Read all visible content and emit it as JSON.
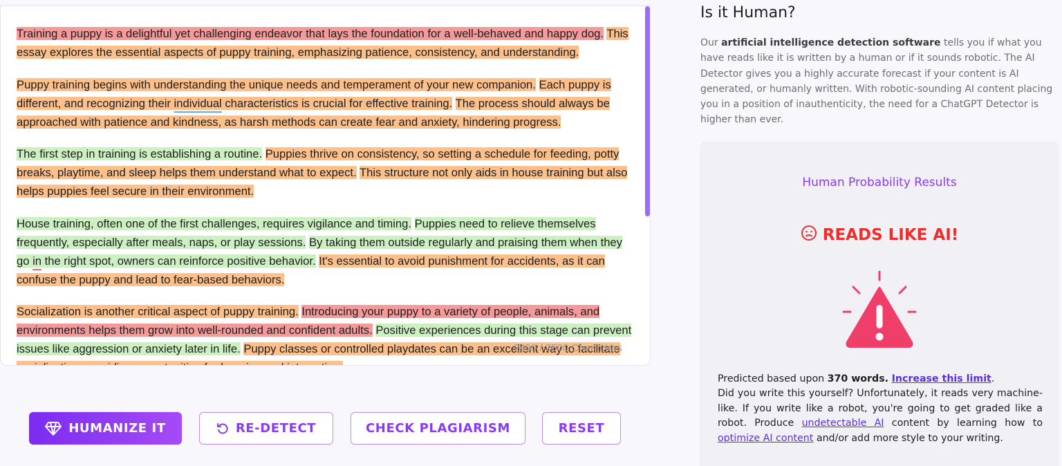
{
  "editor": {
    "paragraphs": [
      [
        {
          "t": "Training a puppy is a delightful yet challenging endeavor that lays the foundation for a well-behaved and happy dog.",
          "c": "s-red"
        },
        {
          "t": " "
        },
        {
          "t": "This essay explores the essential aspects of puppy training, emphasizing patience, consistency, and understanding.",
          "c": "s-orange"
        }
      ],
      [
        {
          "t": "Puppy training begins with understanding the unique needs and temperament of your new companion.",
          "c": "s-orange"
        },
        {
          "t": " "
        },
        {
          "t": "Each puppy is different, and recognizing their ",
          "c": "s-orange"
        },
        {
          "t": "individual",
          "c": "s-orange ul-blue"
        },
        {
          "t": " characteristics is crucial for effective training.",
          "c": "s-orange"
        },
        {
          "t": " "
        },
        {
          "t": "The process should always be approached with patience and kindness, as harsh methods can create fear and anxiety, hindering progress.",
          "c": "s-orange"
        }
      ],
      [
        {
          "t": "The first step in training is establishing a routine.",
          "c": "s-green"
        },
        {
          "t": " "
        },
        {
          "t": "Puppies thrive on consistency, so setting a schedule for feeding, potty breaks, playtime, and sleep helps them understand what to expect.",
          "c": "s-orange"
        },
        {
          "t": " "
        },
        {
          "t": "This structure not only aids in house training but also helps puppies feel secure in their environment.",
          "c": "s-orange"
        }
      ],
      [
        {
          "t": "House training, often one of the first challenges, requires vigilance and timing.",
          "c": "s-green"
        },
        {
          "t": " "
        },
        {
          "t": "Puppies need to relieve themselves frequently, especially after meals, naps, or play sessions.",
          "c": "s-green"
        },
        {
          "t": " "
        },
        {
          "t": "By taking them outside regularly and praising them when they go ",
          "c": "s-green"
        },
        {
          "t": "in",
          "c": "s-green ul-red"
        },
        {
          "t": " the right spot, owners can reinforce positive behavior.",
          "c": "s-green"
        },
        {
          "t": " "
        },
        {
          "t": "It's essential to avoid punishment for accidents, as it can confuse the puppy and lead to fear-based behaviors.",
          "c": "s-orange"
        }
      ],
      [
        {
          "t": "Socialization is another critical aspect of puppy training.",
          "c": "s-orange"
        },
        {
          "t": " "
        },
        {
          "t": "Introducing your puppy to a variety of people, animals, and environments helps them grow into well-rounded and confident adults.",
          "c": "s-red"
        },
        {
          "t": " "
        },
        {
          "t": "Positive experiences during this stage can prevent issues like aggression or anxiety later in life.",
          "c": "s-green"
        },
        {
          "t": " "
        },
        {
          "t": "Puppy classes or controlled playdates can be an excellent way to facilitate socialization, providing opportunities for learning and interaction.",
          "c": "s-orange"
        }
      ]
    ],
    "char_count": "2490 / 2500 Characters"
  },
  "buttons": {
    "humanize": "HUMANIZE IT",
    "redetect": "RE-DETECT",
    "plagiarism": "CHECK PLAGIARISM",
    "reset": "RESET"
  },
  "panel": {
    "title": "Is it Human?",
    "intro_pre": "Our ",
    "intro_bold": "artificial intelligence detection software",
    "intro_post": " tells you if what you have reads like it is written by a human or if it sounds robotic. The AI Detector gives you a highly accurate forecast if your content is AI generated, or humanly written. With robotic-sounding AI content placing you in a position of inauthenticity, the need for a ChatGPT Detector is higher than ever.",
    "results_heading": "Human Probability Results",
    "verdict": "READS LIKE AI!",
    "pred_pre": "Predicted based upon ",
    "pred_words": "370 words.",
    "pred_link": "Increase this limit",
    "pred_dot": ".",
    "body_1": "Did you write this yourself? Unfortunately, it reads very machine-like. If you write like a robot, you're going to get graded like a robot. Produce ",
    "link_undetectable": "undetectable AI",
    "body_2": " content by learning how to ",
    "link_optimize": "optimize AI content",
    "body_3": " and/or add more style to your writing."
  },
  "colors": {
    "accent": "#8a3bf0",
    "danger": "#ee2d2d",
    "warning_triangle": "#ef3e6a",
    "highlight_red": "#f59a9a",
    "highlight_orange": "#fdc08a",
    "highlight_green": "#cdf0c3"
  },
  "icons": {
    "humanize": "diamond-icon",
    "redetect": "refresh-icon",
    "verdict": "sad-face-icon",
    "warning": "warning-triangle-icon"
  }
}
